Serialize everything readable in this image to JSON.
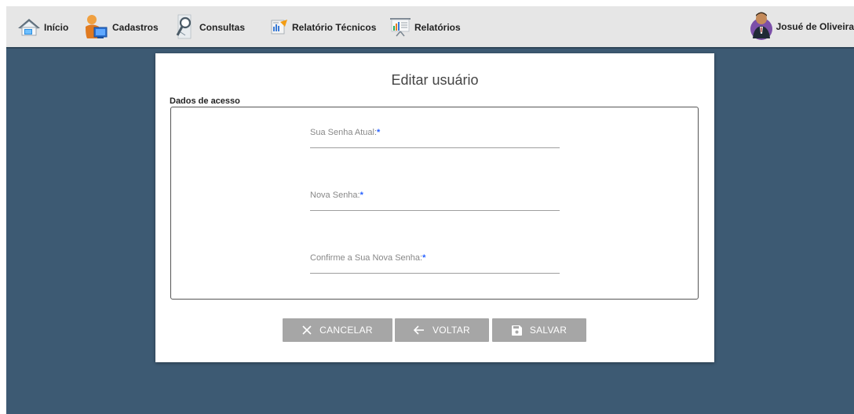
{
  "nav": {
    "items": [
      {
        "label": "Início",
        "icon": "home-icon"
      },
      {
        "label": "Cadastros",
        "icon": "user-register-icon"
      },
      {
        "label": "Consultas",
        "icon": "magnifier-icon"
      },
      {
        "label": "Relatório Técnicos",
        "icon": "technical-report-icon"
      },
      {
        "label": "Relatórios",
        "icon": "presentation-chart-icon"
      }
    ],
    "user_name": "Josué de Oliveira"
  },
  "form": {
    "title": "Editar usuário",
    "section_legend": "Dados de acesso",
    "fields": [
      {
        "label": "Sua Senha Atual:",
        "required_mark": "*",
        "value": ""
      },
      {
        "label": "Nova Senha:",
        "required_mark": "*",
        "value": ""
      },
      {
        "label": "Confirme a Sua Nova Senha:",
        "required_mark": "*",
        "value": ""
      }
    ],
    "buttons": {
      "cancel": "CANCELAR",
      "back": "VOLTAR",
      "save": "SALVAR"
    }
  },
  "colors": {
    "background": "#3d5a73",
    "topbar": "#e6e6e6",
    "button": "#a6a6a6",
    "required": "#2962ff"
  }
}
